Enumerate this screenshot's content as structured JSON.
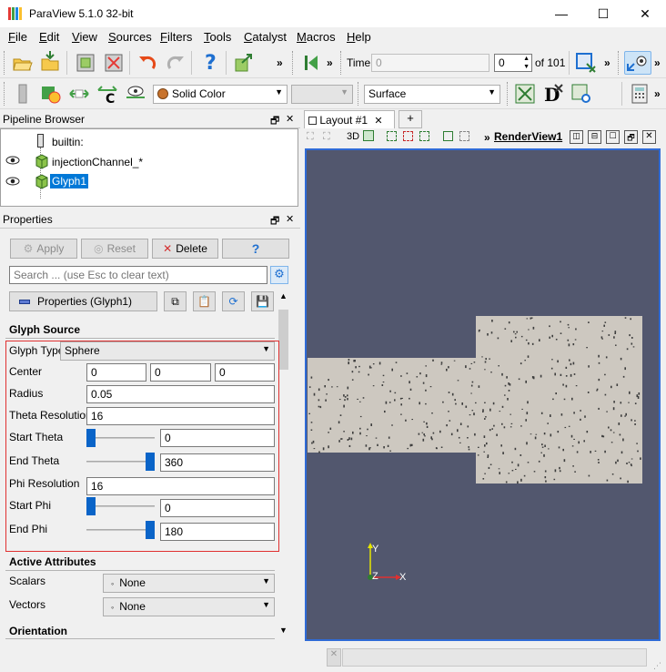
{
  "window": {
    "title": "ParaView 5.1.0 32-bit",
    "minimize": "—",
    "maximize": "☐",
    "close": "✕"
  },
  "menubar": [
    {
      "label": "File",
      "u": "F",
      "rest": "ile"
    },
    {
      "label": "Edit",
      "u": "E",
      "rest": "dit"
    },
    {
      "label": "View",
      "u": "V",
      "rest": "iew"
    },
    {
      "label": "Sources",
      "u": "S",
      "rest": "ources"
    },
    {
      "label": "Filters",
      "u": "F",
      "rest": "ilters"
    },
    {
      "label": "Tools",
      "u": "T",
      "rest": "ools"
    },
    {
      "label": "Catalyst",
      "u": "C",
      "rest": "atalyst"
    },
    {
      "label": "Macros",
      "u": "M",
      "rest": "acros"
    },
    {
      "label": "Help",
      "u": "H",
      "rest": "elp"
    }
  ],
  "toolbar": {
    "time_label": "Time:",
    "time_value": "0",
    "timestep_value": "0",
    "timestep_of": "of 101",
    "coloring_value": "Solid Color",
    "representation_value": "Surface",
    "more_chevron": "»"
  },
  "pipeline_browser": {
    "title": "Pipeline Browser",
    "items": [
      {
        "label": "builtin:",
        "visible": false,
        "selected": false
      },
      {
        "label": "injectionChannel_*",
        "visible": true,
        "selected": false
      },
      {
        "label": "Glyph1",
        "visible": true,
        "selected": true
      }
    ]
  },
  "properties": {
    "title": "Properties",
    "apply": "Apply",
    "reset": "Reset",
    "delete": "Delete",
    "help": "?",
    "search_placeholder": "Search ... (use Esc to clear text)",
    "section_button": "Properties (Glyph1)",
    "glyph_source_heading": "Glyph Source",
    "glyph_type_label": "Glyph Type",
    "glyph_type_value": "Sphere",
    "center_label": "Center",
    "center": [
      "0",
      "0",
      "0"
    ],
    "radius_label": "Radius",
    "radius": "0.05",
    "theta_res_label": "Theta Resolution",
    "theta_res": "16",
    "start_theta_label": "Start Theta",
    "start_theta": "0",
    "end_theta_label": "End Theta",
    "end_theta": "360",
    "phi_res_label": "Phi Resolution",
    "phi_res": "16",
    "start_phi_label": "Start Phi",
    "start_phi": "0",
    "end_phi_label": "End Phi",
    "end_phi": "180",
    "sliders": {
      "start_theta": 0.0,
      "end_theta": 1.0,
      "start_phi": 0.0,
      "end_phi": 1.0
    },
    "active_attributes_heading": "Active Attributes",
    "scalars_label": "Scalars",
    "scalars_value": "None",
    "vectors_label": "Vectors",
    "vectors_value": "None",
    "orientation_heading": "Orientation"
  },
  "layout": {
    "tab_label": "Layout #1",
    "tab_close": "✕",
    "add_tab": "+",
    "view_3d": "3D",
    "render_view_label": "RenderView1",
    "axis_x": "X",
    "axis_y": "Y",
    "axis_z": "Z"
  },
  "colors": {
    "viewport_bg": "#52576e",
    "geometry": "#cdc8c0",
    "selection": "#0078d7",
    "highlight_border": "#e03030"
  }
}
